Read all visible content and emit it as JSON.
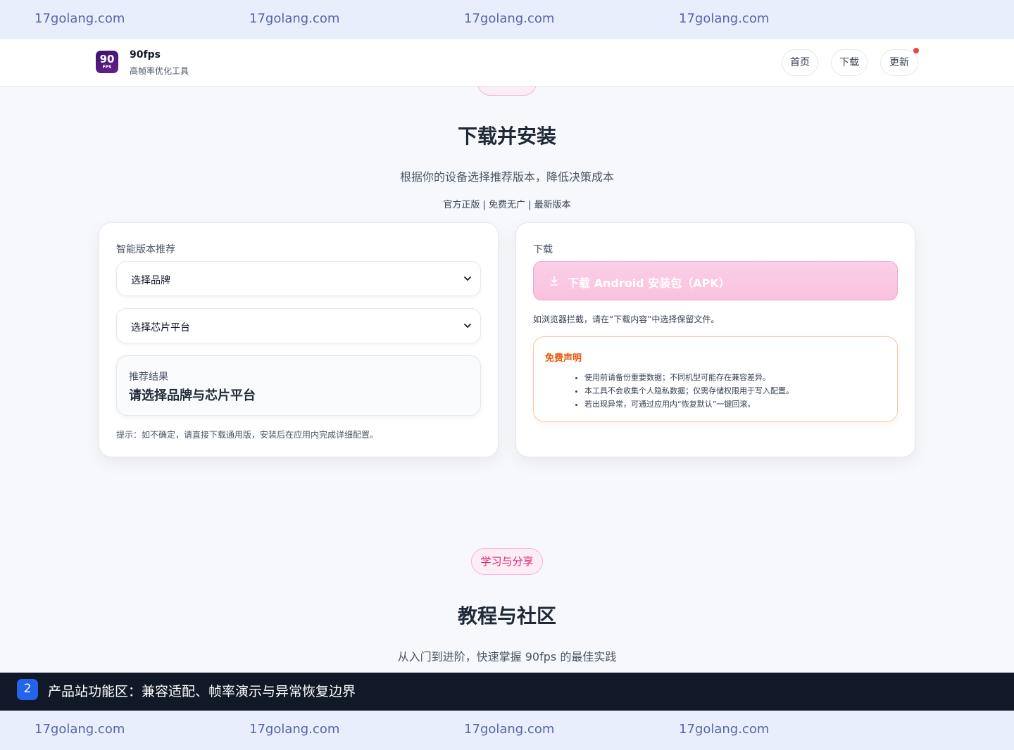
{
  "watermark": {
    "text": "17golang.com"
  },
  "header": {
    "logo_big": "90",
    "logo_small": "FPS",
    "brand_name": "90fps",
    "brand_sub": "高帧率优化工具",
    "nav": {
      "home": "首页",
      "download": "下载",
      "update": "更新"
    }
  },
  "download_section": {
    "title": "下载并安装",
    "subtitle": "根据你的设备选择推荐版本，降低决策成本",
    "tagline": "官方正版 | 免费无广 | 最新版本"
  },
  "recommend_card": {
    "label": "智能版本推荐",
    "brand_select": "选择品牌",
    "chip_select": "选择芯片平台",
    "result_label": "推荐结果",
    "result_value": "请选择品牌与芯片平台",
    "hint": "提示：如不确定，请直接下载通用版，安装后在应用内完成详细配置。"
  },
  "download_card": {
    "label": "下载",
    "button": "下载 Android 安装包（APK）",
    "browser_note": "如浏览器拦截，请在“下载内容”中选择保留文件。",
    "disclaimer_title": "免费声明",
    "disclaimer_items": [
      "使用前请备份重要数据；不同机型可能存在兼容差异。",
      "本工具不会收集个人隐私数据；仅需存储权限用于写入配置。",
      "若出现异常，可通过应用内“恢复默认”一键回滚。"
    ]
  },
  "tutorial_section": {
    "pill": "学习与分享",
    "title": "教程与社区",
    "subtitle": "从入门到进阶，快速掌握 90fps 的最佳实践"
  },
  "caption": {
    "number": "2",
    "text": "产品站功能区：兼容适配、帧率演示与异常恢复边界"
  },
  "colors": {
    "accent_pink": "#f9c2de",
    "warning_orange": "#ea580c",
    "notify_red": "#ef4444",
    "caption_blue": "#2563eb"
  }
}
